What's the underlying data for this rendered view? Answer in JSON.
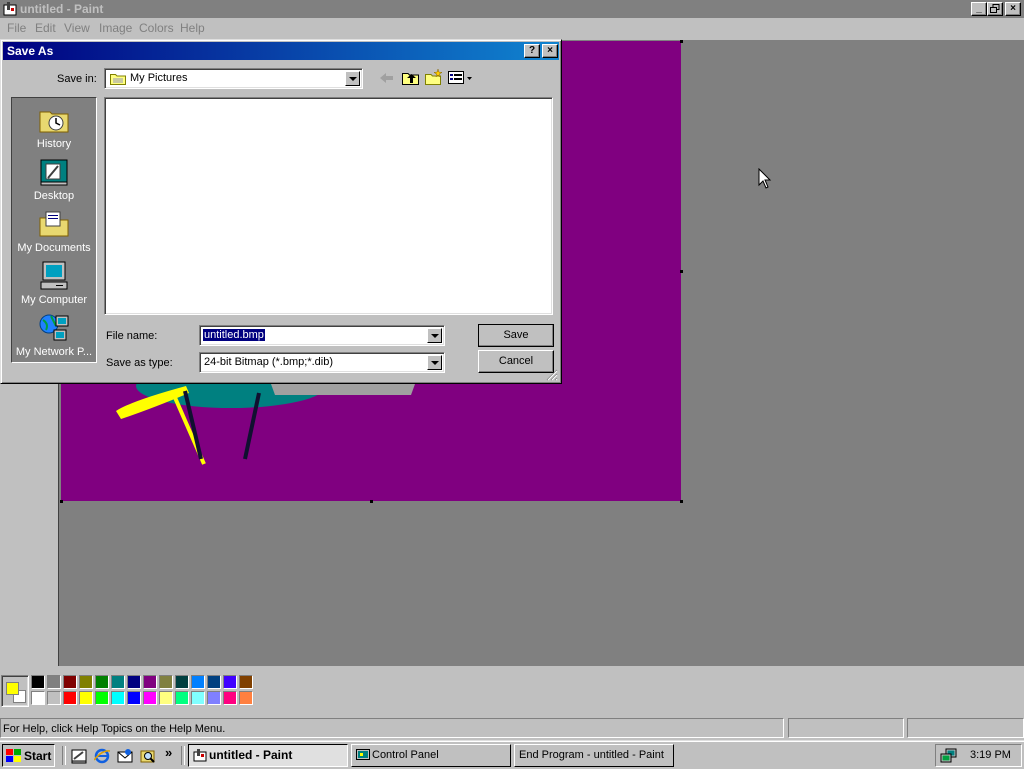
{
  "paint": {
    "title": "untitled - Paint",
    "menu": [
      "File",
      "Edit",
      "View",
      "Image",
      "Colors",
      "Help"
    ],
    "status_text": "For Help, click Help Topics on the Help Menu."
  },
  "dialog": {
    "title": "Save As",
    "help_btn": "?",
    "close_btn": "×",
    "save_in_label": "Save in:",
    "save_in_value": "My Pictures",
    "places": [
      "History",
      "Desktop",
      "My Documents",
      "My Computer",
      "My Network P..."
    ],
    "file_name_label": "File name:",
    "file_name_value": "untitled.bmp",
    "save_as_type_label": "Save as type:",
    "save_as_type_value": "24-bit Bitmap (*.bmp;*.dib)",
    "save_label": "Save",
    "cancel_label": "Cancel"
  },
  "palette": {
    "top_row": [
      "#000000",
      "#808080",
      "#800000",
      "#808000",
      "#008000",
      "#008080",
      "#000080",
      "#800080",
      "#808040",
      "#004040",
      "#0080ff",
      "#004080",
      "#4000ff",
      "#804000"
    ],
    "bottom_row": [
      "#ffffff",
      "#c0c0c0",
      "#ff0000",
      "#ffff00",
      "#00ff00",
      "#00ffff",
      "#0000ff",
      "#ff00ff",
      "#ffff80",
      "#00ff80",
      "#80ffff",
      "#8080ff",
      "#ff0080",
      "#ff8040"
    ],
    "foreground": "#ffff00",
    "background": "#ffffff"
  },
  "canvas": {
    "color": "#800080"
  },
  "taskbar": {
    "start_label": "Start",
    "chevron": "»",
    "buttons": [
      "untitled - Paint",
      "Control Panel",
      "End Program - untitled - Paint"
    ],
    "clock": "3:19 PM"
  }
}
